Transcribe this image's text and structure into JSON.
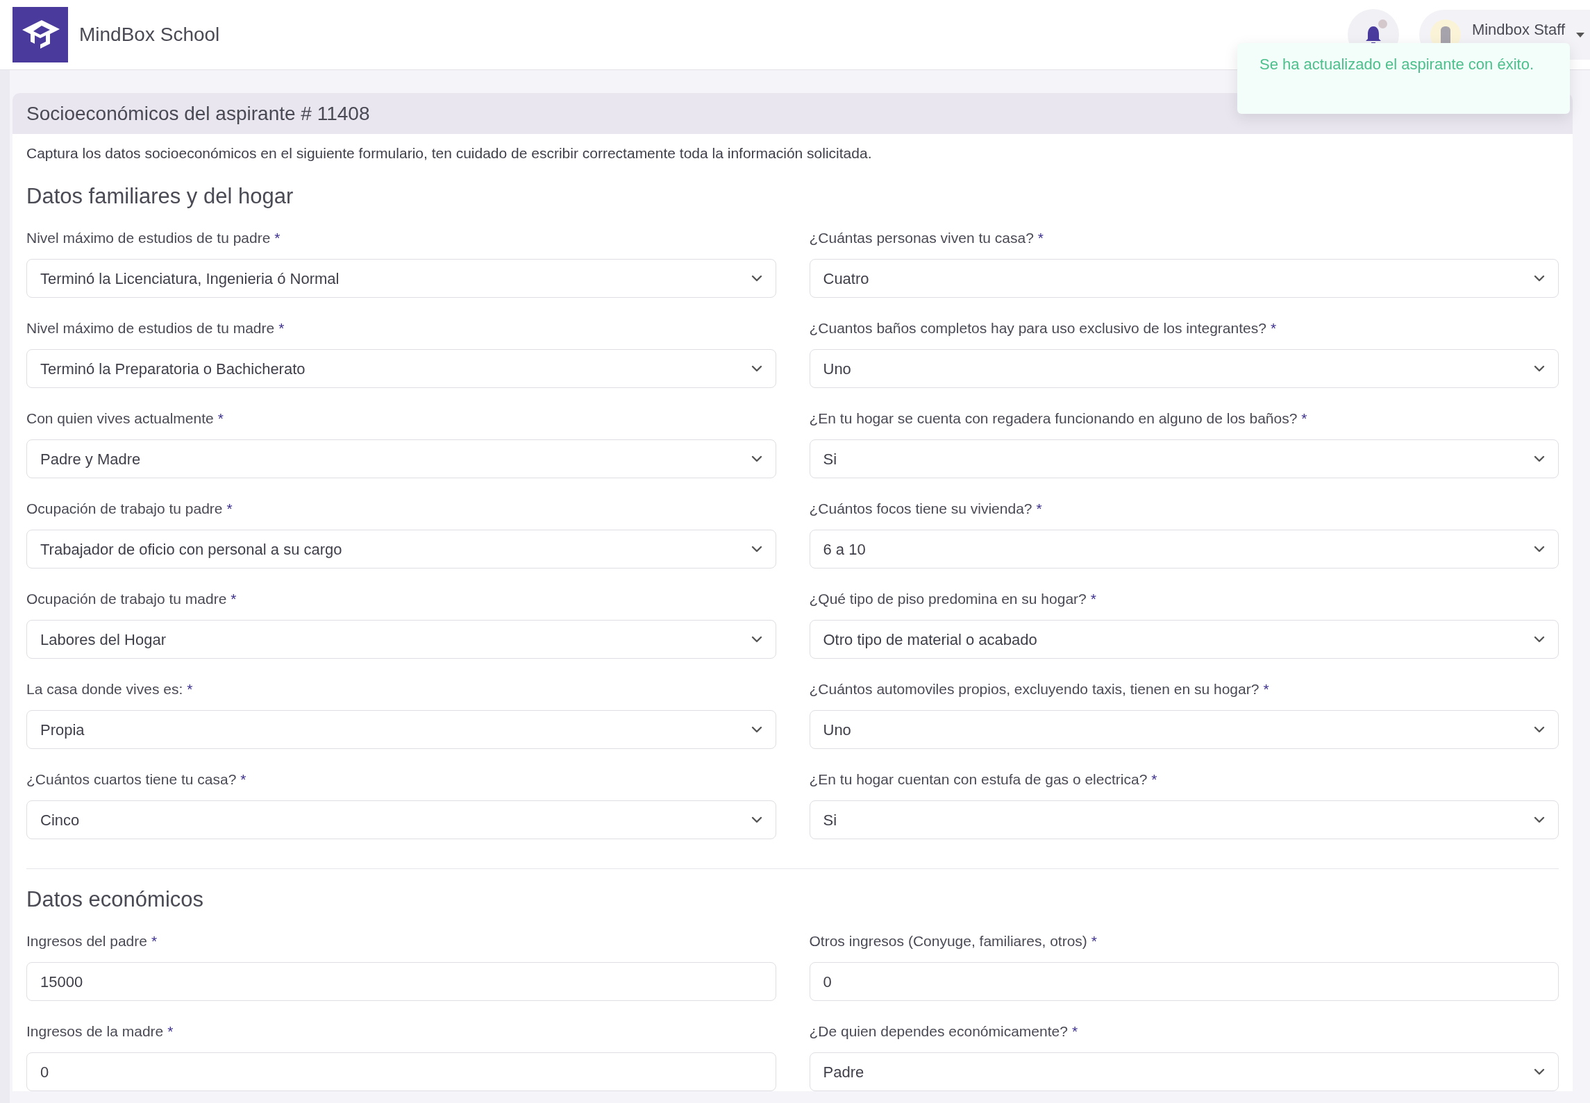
{
  "header": {
    "brand": "MindBox School",
    "user_name": "Mindbox Staff",
    "notification_dot": true
  },
  "toast": {
    "message": "Se ha actualizado el aspirante con éxito."
  },
  "page": {
    "title": "Socioeconómicos del aspirante # 11408",
    "description": "Captura los datos socioeconómicos en el siguiente formulario, ten cuidado de escribir correctamente toda la información solicitada."
  },
  "sections": [
    {
      "title": "Datos familiares y del hogar",
      "fields": [
        {
          "label": "Nivel máximo de estudios de tu padre",
          "required_mark": "*",
          "kind": "select",
          "value": "Terminó la Licenciatura, Ingenieria ó Normal"
        },
        {
          "label": "¿Cuántas personas viven tu casa?",
          "required_mark": "*",
          "kind": "select",
          "value": "Cuatro"
        },
        {
          "label": "Nivel máximo de estudios de tu madre",
          "required_mark": "*",
          "kind": "select",
          "value": "Terminó la Preparatoria o Bachicherato"
        },
        {
          "label": "¿Cuantos baños completos hay para uso exclusivo de los integrantes?",
          "required_mark": "*",
          "kind": "select",
          "value": "Uno"
        },
        {
          "label": "Con quien vives actualmente",
          "required_mark": "*",
          "kind": "select",
          "value": "Padre y Madre"
        },
        {
          "label": "¿En tu hogar se cuenta con regadera funcionando en alguno de los baños?",
          "required_mark": "*",
          "kind": "select",
          "value": "Si"
        },
        {
          "label": "Ocupación de trabajo tu padre",
          "required_mark": "*",
          "kind": "select",
          "value": "Trabajador de oficio con personal a su cargo"
        },
        {
          "label": "¿Cuántos focos tiene su vivienda?",
          "required_mark": "*",
          "kind": "select",
          "value": "6 a 10"
        },
        {
          "label": "Ocupación de trabajo tu madre",
          "required_mark": "*",
          "kind": "select",
          "value": "Labores del Hogar"
        },
        {
          "label": "¿Qué tipo de piso predomina en su hogar?",
          "required_mark": "*",
          "kind": "select",
          "value": "Otro tipo de material o acabado"
        },
        {
          "label": "La casa donde vives es:",
          "required_mark": "*",
          "kind": "select",
          "value": "Propia"
        },
        {
          "label": "¿Cuántos automoviles propios, excluyendo taxis, tienen en su hogar?",
          "required_mark": "*",
          "kind": "select",
          "value": "Uno"
        },
        {
          "label": "¿Cuántos cuartos tiene tu casa?",
          "required_mark": "*",
          "kind": "select",
          "value": "Cinco"
        },
        {
          "label": "¿En tu hogar cuentan con estufa de gas o electrica?",
          "required_mark": "*",
          "kind": "select",
          "value": "Si"
        }
      ]
    },
    {
      "title": "Datos económicos",
      "fields": [
        {
          "label": "Ingresos del padre",
          "required_mark": "*",
          "kind": "input",
          "value": "15000"
        },
        {
          "label": "Otros ingresos (Conyuge, familiares, otros)",
          "required_mark": "*",
          "kind": "input",
          "value": "0"
        },
        {
          "label": "Ingresos de la madre",
          "required_mark": "*",
          "kind": "input",
          "value": "0"
        },
        {
          "label": "¿De quien dependes económicamente?",
          "required_mark": "*",
          "kind": "select",
          "value": "Padre"
        }
      ]
    }
  ]
}
